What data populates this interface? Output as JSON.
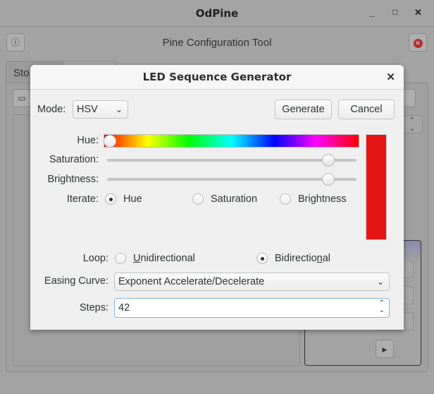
{
  "window": {
    "title": "OdPine",
    "minimize": "_",
    "maximize": "□",
    "close": "✕"
  },
  "app": {
    "title": "Pine Configuration Tool",
    "tabs": [
      {
        "label": "Sto"
      },
      {
        "label": ""
      }
    ]
  },
  "dialog": {
    "title": "LED Sequence Generator",
    "close": "✕",
    "mode_label": "Mode:",
    "mode_value": "HSV",
    "generate": "Generate",
    "cancel": "Cancel",
    "hue_label": "Hue:",
    "hue_value": 0,
    "saturation_label": "Saturation:",
    "saturation_value": 0.9,
    "brightness_label": "Brightness:",
    "brightness_value": 0.9,
    "preview_color": "#e51515",
    "iterate_label": "Iterate:",
    "iterate_options": [
      {
        "label": "Hue",
        "checked": true
      },
      {
        "label": "Saturation",
        "checked": false
      },
      {
        "label": "Brightness",
        "checked": false
      }
    ],
    "loop_label": "Loop:",
    "loop_options": [
      {
        "pre": "",
        "mn": "U",
        "post": "nidirectional",
        "checked": false
      },
      {
        "pre": "Bidirectio",
        "mn": "n",
        "post": "al",
        "checked": true
      }
    ],
    "easing_label": "Easing Curve:",
    "easing_value": "Exponent Accelerate/Decelerate",
    "steps_label": "Steps:",
    "steps_value": "42"
  }
}
